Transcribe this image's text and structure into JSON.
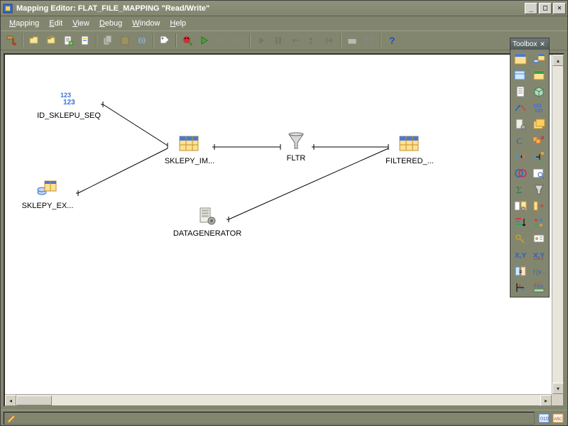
{
  "title": "Mapping Editor: FLAT_FILE_MAPPING \"Read/Write\"",
  "menu": {
    "mapping": "Mapping",
    "edit": "Edit",
    "view": "View",
    "debug": "Debug",
    "window": "Window",
    "help": "Help"
  },
  "toolbox": {
    "title": "Toolbox"
  },
  "nodes": {
    "seq": {
      "label": "ID_SKLEPU_SEQ"
    },
    "ext": {
      "label": "SKLEPY_EX..."
    },
    "imp": {
      "label": "SKLEPY_IM..."
    },
    "fltr": {
      "label": "FLTR"
    },
    "filtered": {
      "label": "FILTERED_..."
    },
    "datagen": {
      "label": "DATAGENERATOR"
    }
  }
}
